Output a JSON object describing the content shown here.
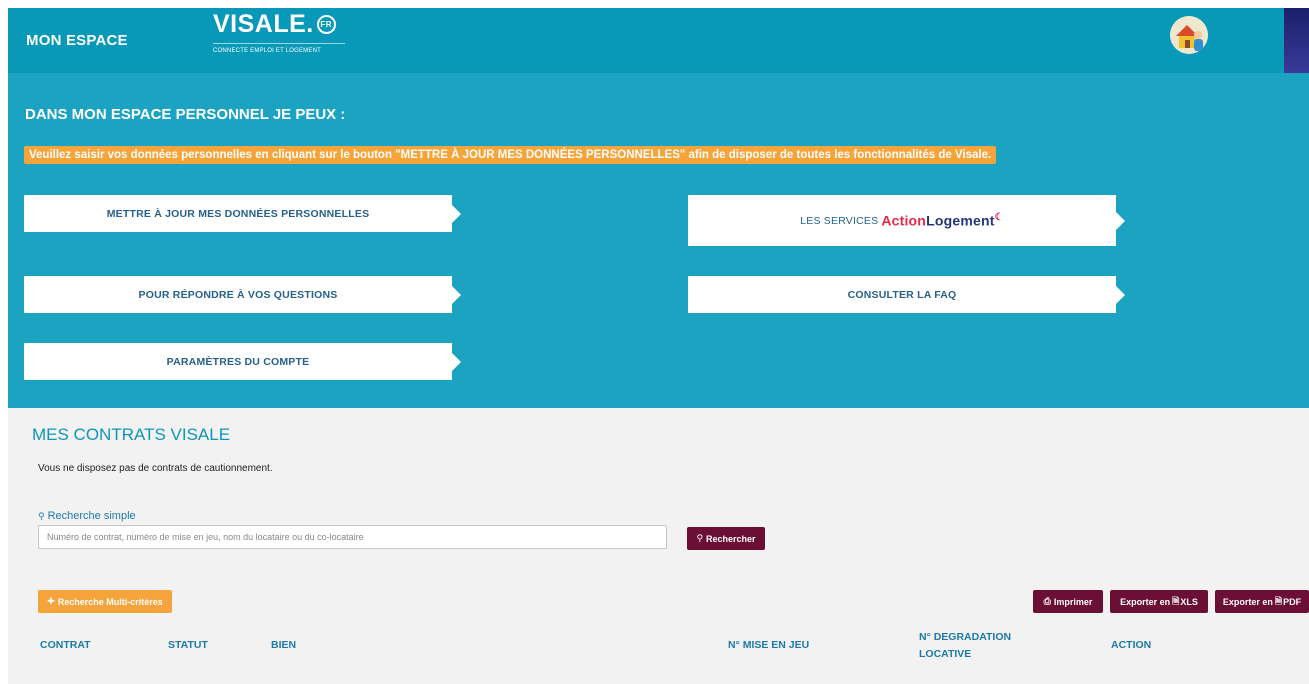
{
  "header": {
    "title": "MON ESPACE",
    "logo_text": "VISALE.",
    "logo_badge": "FR",
    "logo_tagline": "CONNECTE EMPLOI ET LOGEMENT"
  },
  "perso": {
    "heading": "DANS MON ESPACE PERSONNEL JE PEUX :",
    "warning": "Veuillez saisir vos données personnelles en cliquant sur le bouton \"METTRE À JOUR MES DONNÉES PERSONNELLES\" afin de disposer de toutes les fonctionnalités de Visale.",
    "cards": {
      "update": "METTRE À JOUR MES DONNÉES PERSONNELLES",
      "services_prefix": "LES SERVICES",
      "services_brand_a": "Action",
      "services_brand_b": "Logement",
      "questions": "POUR RÉPONDRE À VOS QUESTIONS",
      "faq": "CONSULTER LA FAQ",
      "params": "PARAMÈTRES DU COMPTE"
    }
  },
  "contracts": {
    "title": "MES CONTRATS VISALE",
    "no_contract": "Vous ne disposez pas de contrats de cautionnement.",
    "simple_search_label": "Recherche simple",
    "search_placeholder": "Numéro de contrat, numéro de mise en jeu, nom du locataire ou du co-locataire",
    "search_button": "Rechercher",
    "multi_button": "Recherche Multi-critères",
    "print_button": "Imprimer",
    "export_xls": "Exporter en",
    "export_xls_suffix": "XLS",
    "export_pdf": "Exporter en",
    "export_pdf_suffix": "PDF",
    "columns": {
      "contrat": "CONTRAT",
      "statut": "STATUT",
      "bien": "BIEN",
      "mise_en_jeu": "N° MISE EN JEU",
      "degradation_1": "N° DEGRADATION",
      "degradation_2": "LOCATIVE",
      "action": "ACTION"
    }
  },
  "icons": {
    "search": "search-icon",
    "plus": "plus-icon",
    "print": "print-icon",
    "file": "file-icon"
  },
  "colors": {
    "header": "#0899b8",
    "panel": "#1da3c2",
    "warning": "#f5a43b",
    "dark_button": "#6b0f34",
    "link": "#1e79a8"
  }
}
